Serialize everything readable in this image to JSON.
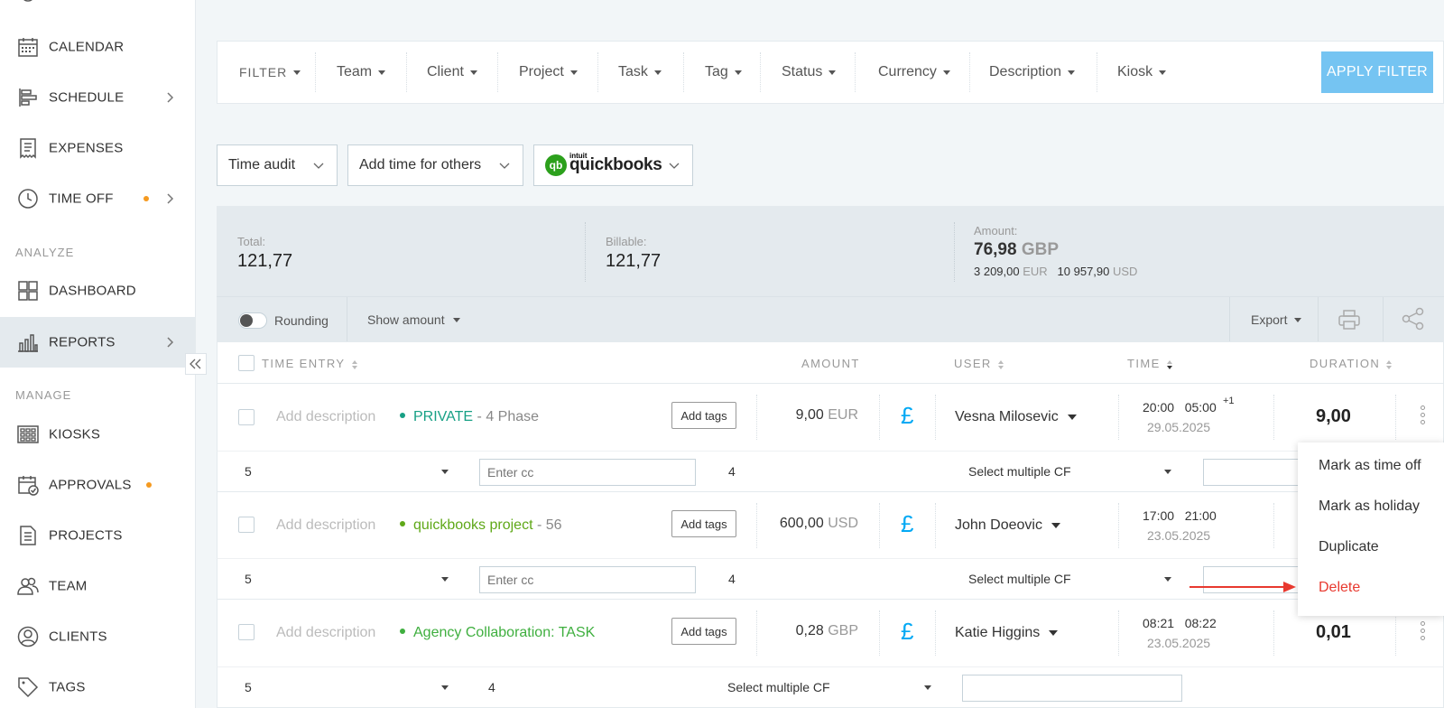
{
  "sidebar": {
    "items": [
      {
        "label": "CALENDAR",
        "icon": "calendar-icon"
      },
      {
        "label": "SCHEDULE",
        "icon": "schedule-icon"
      },
      {
        "label": "EXPENSES",
        "icon": "receipt-icon"
      },
      {
        "label": "TIME OFF",
        "icon": "clock-icon"
      },
      {
        "label": "DASHBOARD",
        "icon": "dashboard-icon"
      },
      {
        "label": "REPORTS",
        "icon": "bar-chart-icon"
      },
      {
        "label": "KIOSKS",
        "icon": "kiosk-icon"
      },
      {
        "label": "APPROVALS",
        "icon": "approvals-icon"
      },
      {
        "label": "PROJECTS",
        "icon": "document-icon"
      },
      {
        "label": "TEAM",
        "icon": "team-icon"
      },
      {
        "label": "CLIENTS",
        "icon": "client-icon"
      },
      {
        "label": "TAGS",
        "icon": "tag-icon"
      }
    ],
    "sections": {
      "analyze": "ANALYZE",
      "manage": "MANAGE"
    },
    "badge_color": "#f59a20"
  },
  "filters": {
    "items": [
      "FILTER",
      "Team",
      "Client",
      "Project",
      "Task",
      "Tag",
      "Status",
      "Currency",
      "Description",
      "Kiosk"
    ],
    "apply_label": "APPLY FILTER"
  },
  "dropdowns": {
    "audit": "Time audit",
    "add_time": "Add time for others",
    "qb_small": "intuit",
    "qb_word": "quickbooks",
    "qb_mark": "qb"
  },
  "summary": {
    "total_label": "Total:",
    "total_value": "121,77",
    "billable_label": "Billable:",
    "billable_value": "121,77",
    "amount_label": "Amount:",
    "amount_value": "76,98",
    "amount_currency": "GBP",
    "eur_value": "3 209,00",
    "eur_currency": "EUR",
    "usd_value": "10 957,90",
    "usd_currency": "USD"
  },
  "toolbar": {
    "rounding": "Rounding",
    "show_amount": "Show amount",
    "export": "Export"
  },
  "table": {
    "headers": {
      "entry": "TIME ENTRY",
      "amount": "AMOUNT",
      "user": "USER",
      "time": "TIME",
      "duration": "DURATION"
    },
    "rows": [
      {
        "description": "Add description",
        "project": "PRIVATE",
        "task": " - 4 Phase",
        "project_color": "#17a085",
        "add_tags": "Add tags",
        "amount": "9,00",
        "currency": "EUR",
        "pound": "£",
        "user": "Vesna Milosevic",
        "start": "20:00",
        "end": "05:00",
        "plus": "+1",
        "date": "29.05.2025",
        "duration": "9,00",
        "cf": {
          "num1": "5",
          "cc_placeholder": "Enter cc",
          "num2": "4",
          "select": "Select multiple CF"
        }
      },
      {
        "description": "Add description",
        "project": "quickbooks project",
        "task": " - 56",
        "project_color": "#5fa818",
        "add_tags": "Add tags",
        "amount": "600,00",
        "currency": "USD",
        "pound": "£",
        "user": "John Doeovic",
        "start": "17:00",
        "end": "21:00",
        "date": "23.05.2025",
        "cf": {
          "num1": "5",
          "cc_placeholder": "Enter cc",
          "num2": "4",
          "select": "Select multiple CF"
        }
      },
      {
        "description": "Add description",
        "project": "Agency Collaboration: TASK",
        "task": "",
        "project_color": "#3faf3f",
        "add_tags": "Add tags",
        "amount": "0,28",
        "currency": "GBP",
        "pound": "£",
        "user": "Katie Higgins",
        "start": "08:21",
        "end": "08:22",
        "date": "23.05.2025",
        "duration": "0,01",
        "cf": {
          "num1": "5",
          "num2": "4",
          "select": "Select multiple CF"
        }
      }
    ]
  },
  "context_menu": {
    "items": [
      "Mark as time off",
      "Mark as holiday",
      "Duplicate",
      "Delete"
    ],
    "danger_color": "#e8392f"
  },
  "colors": {
    "accent": "#03a9f4",
    "apply_button": "#75c4f2"
  }
}
